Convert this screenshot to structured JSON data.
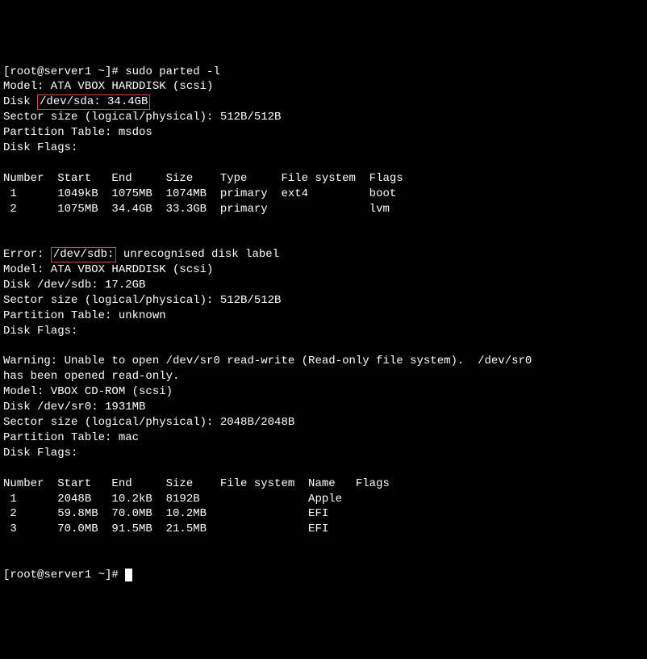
{
  "prompt1": "[root@server1 ~]# ",
  "cmd": "sudo parted -l",
  "sda": {
    "model": "Model: ATA VBOX HARDDISK (scsi)",
    "disk_label": "Disk ",
    "disk_boxed": "/dev/sda: 34.4GB",
    "sector": "Sector size (logical/physical): 512B/512B",
    "ptable": "Partition Table: msdos",
    "flags": "Disk Flags:",
    "header": "Number  Start   End     Size    Type     File system  Flags",
    "rows": [
      " 1      1049kB  1075MB  1074MB  primary  ext4         boot",
      " 2      1075MB  34.4GB  33.3GB  primary               lvm"
    ]
  },
  "sdb": {
    "error_pre": "Error: ",
    "error_boxed": "/dev/sdb:",
    "error_post": " unrecognised disk label",
    "model": "Model: ATA VBOX HARDDISK (scsi)",
    "disk": "Disk /dev/sdb: 17.2GB",
    "sector": "Sector size (logical/physical): 512B/512B",
    "ptable": "Partition Table: unknown",
    "flags": "Disk Flags:"
  },
  "sr0": {
    "warn1": "Warning: Unable to open /dev/sr0 read-write (Read-only file system).  /dev/sr0",
    "warn2": "has been opened read-only.",
    "model": "Model: VBOX CD-ROM (scsi)",
    "disk": "Disk /dev/sr0: 1931MB",
    "sector": "Sector size (logical/physical): 2048B/2048B",
    "ptable": "Partition Table: mac",
    "flags": "Disk Flags:",
    "header": "Number  Start   End     Size    File system  Name   Flags",
    "rows": [
      " 1      2048B   10.2kB  8192B                Apple",
      " 2      59.8MB  70.0MB  10.2MB               EFI",
      " 3      70.0MB  91.5MB  21.5MB               EFI"
    ]
  },
  "prompt2": "[root@server1 ~]# ",
  "chart_data": {
    "type": "table",
    "tables": [
      {
        "title": "/dev/sda partitions",
        "columns": [
          "Number",
          "Start",
          "End",
          "Size",
          "Type",
          "File system",
          "Flags"
        ],
        "rows": [
          [
            1,
            "1049kB",
            "1075MB",
            "1074MB",
            "primary",
            "ext4",
            "boot"
          ],
          [
            2,
            "1075MB",
            "34.4GB",
            "33.3GB",
            "primary",
            "",
            "lvm"
          ]
        ]
      },
      {
        "title": "/dev/sr0 partitions",
        "columns": [
          "Number",
          "Start",
          "End",
          "Size",
          "File system",
          "Name",
          "Flags"
        ],
        "rows": [
          [
            1,
            "2048B",
            "10.2kB",
            "8192B",
            "",
            "Apple",
            ""
          ],
          [
            2,
            "59.8MB",
            "70.0MB",
            "10.2MB",
            "",
            "EFI",
            ""
          ],
          [
            3,
            "70.0MB",
            "91.5MB",
            "21.5MB",
            "",
            "EFI",
            ""
          ]
        ]
      }
    ]
  }
}
